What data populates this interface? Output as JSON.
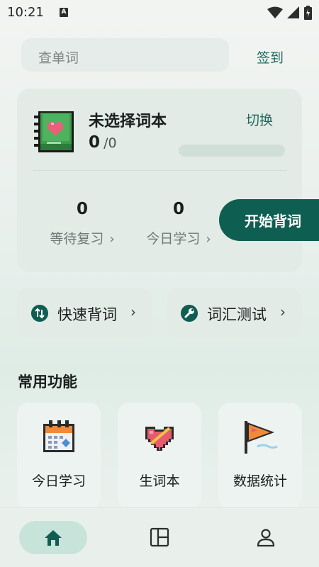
{
  "status_bar": {
    "time": "10:21",
    "notification_badge": "A"
  },
  "search": {
    "placeholder": "查单词"
  },
  "header": {
    "checkin_label": "签到"
  },
  "book": {
    "title": "未选择词本",
    "learned": "0",
    "total": "/0",
    "switch_label": "切换",
    "progress": 0
  },
  "stats": [
    {
      "value": "0",
      "label": "等待复习"
    },
    {
      "value": "0",
      "label": "今日学习"
    }
  ],
  "start_button": {
    "label": "开始背词"
  },
  "quick_actions": [
    {
      "label": "快速背词",
      "icon": "sync-arrows-icon"
    },
    {
      "label": "词汇测试",
      "icon": "wrench-icon"
    }
  ],
  "section": {
    "title": "常用功能"
  },
  "functions": [
    {
      "label": "今日学习",
      "icon": "calendar-icon"
    },
    {
      "label": "生词本",
      "icon": "heart-icon"
    },
    {
      "label": "数据统计",
      "icon": "pennant-flag-icon"
    }
  ],
  "nav": [
    "home-icon",
    "layout-icon",
    "profile-icon"
  ],
  "colors": {
    "accent": "#0f5e52",
    "accent_text": "#1f6a5c",
    "card": "#e3ebe7",
    "nav_pill": "#c8e3da"
  }
}
